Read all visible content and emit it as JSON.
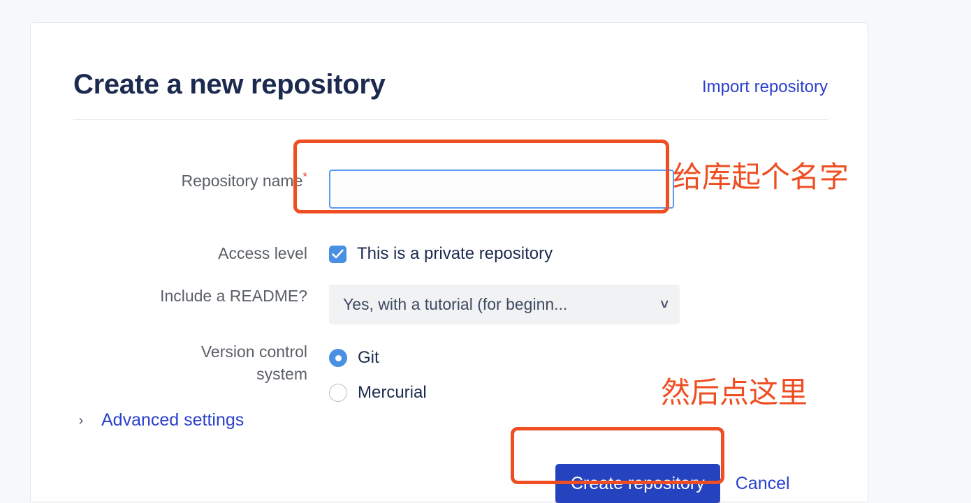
{
  "card": {
    "header": {
      "title": "Create a new repository",
      "import_link": "Import repository"
    },
    "form": {
      "repository_name": {
        "label": "Repository name",
        "required_marker": "*",
        "value": "",
        "placeholder": ""
      },
      "access_level": {
        "label": "Access level",
        "checkbox_label": "This is a private repository",
        "checked": true
      },
      "readme": {
        "label": "Include a README?",
        "selected_option": "Yes, with a tutorial (for beginn...",
        "chevron": "˅"
      },
      "version_control": {
        "label_line1": "Version control",
        "label_line2": "system",
        "options": [
          {
            "label": "Git",
            "selected": true
          },
          {
            "label": "Mercurial",
            "selected": false
          }
        ]
      },
      "advanced_settings": {
        "label": "Advanced settings",
        "chevron": "›"
      }
    },
    "actions": {
      "submit_label": "Create repository",
      "cancel_label": "Cancel"
    }
  },
  "annotations": {
    "name_hint": "给库起个名字",
    "create_hint": "然后点这里"
  },
  "colors": {
    "page_background": "#f7f8f9",
    "card_background": "#ffffff",
    "title": "#1b2a4e",
    "link": "#2b41cc",
    "label": "#5a5f66",
    "accent_blue": "#4a90e2",
    "primary_button": "#2543bf",
    "annotation_orange": "#ee4e21",
    "required_red": "#e34234"
  }
}
